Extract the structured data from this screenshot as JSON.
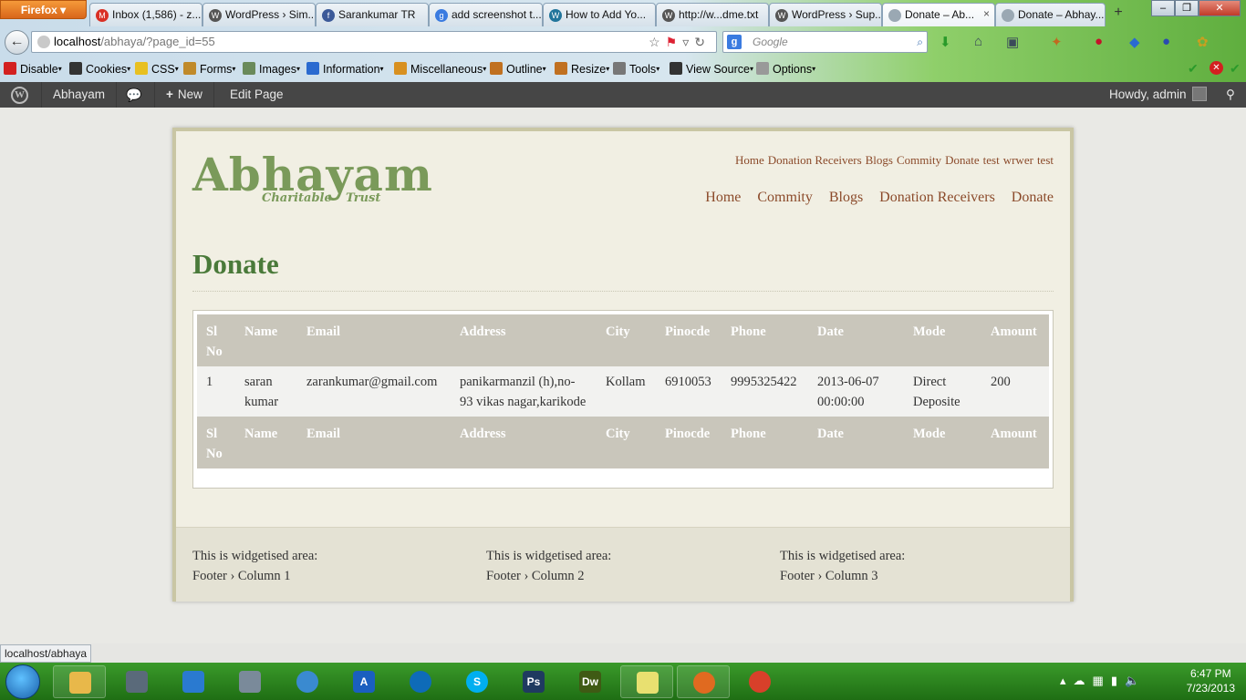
{
  "browser": {
    "app_button": "Firefox",
    "tabs": [
      {
        "label": "Inbox (1,586) - z...",
        "icon": "gmail-icon",
        "color": "#d93025",
        "glyph": "M"
      },
      {
        "label": "WordPress › Sim...",
        "icon": "wordpress-icon",
        "color": "#555555",
        "glyph": "W"
      },
      {
        "label": "Sarankumar TR",
        "icon": "facebook-icon",
        "color": "#3b5998",
        "glyph": "f"
      },
      {
        "label": "add screenshot t...",
        "icon": "google-icon",
        "color": "#3a7be0",
        "glyph": "g"
      },
      {
        "label": "How to Add Yo...",
        "icon": "wordpress-icon",
        "color": "#21759b",
        "glyph": "W"
      },
      {
        "label": "http://w...dme.txt",
        "icon": "wordpress-icon",
        "color": "#555555",
        "glyph": "W"
      },
      {
        "label": "WordPress › Sup...",
        "icon": "wordpress-icon",
        "color": "#555555",
        "glyph": "W"
      },
      {
        "label": "Donate – Ab...",
        "icon": "page-icon",
        "color": "#9aa8b3",
        "glyph": "",
        "active": true
      },
      {
        "label": "Donate – Abhay...",
        "icon": "page-icon",
        "color": "#9aa8b3",
        "glyph": ""
      }
    ],
    "new_tab": "+",
    "url_host": "localhost",
    "url_path": "/abhaya/?page_id=55",
    "search_placeholder": "Google",
    "search_engine": "g"
  },
  "webdev_toolbar": [
    {
      "label": "Disable",
      "color": "#d32020"
    },
    {
      "label": "Cookies",
      "color": "#333333"
    },
    {
      "label": "CSS",
      "color": "#e8c020"
    },
    {
      "label": "Forms",
      "color": "#c08a2a"
    },
    {
      "label": "Images",
      "color": "#6a8a5a"
    },
    {
      "label": "Information",
      "color": "#2a6ad0"
    },
    {
      "label": "Miscellaneous",
      "color": "#d89020"
    },
    {
      "label": "Outline",
      "color": "#c07020"
    },
    {
      "label": "Resize",
      "color": "#c07020"
    },
    {
      "label": "Tools",
      "color": "#777777"
    },
    {
      "label": "View Source",
      "color": "#333333"
    },
    {
      "label": "Options",
      "color": "#999999"
    }
  ],
  "admin_bar": {
    "site_name": "Abhayam",
    "new_label": "New",
    "new_prefix": "+",
    "edit_label": "Edit Page",
    "greeting": "Howdy, admin"
  },
  "site": {
    "logo_title": "Abhayam",
    "logo_sub_1": "Charitable",
    "logo_sub_2": "Trust",
    "top_menu": [
      "Home",
      "Donation Receivers",
      "Blogs",
      "Commity",
      "Donate",
      "test",
      "wrwer",
      "test"
    ],
    "main_menu": [
      "Home",
      "Commity",
      "Blogs",
      "Donation Receivers",
      "Donate"
    ],
    "page_title": "Donate",
    "table": {
      "headers": [
        "Sl No",
        "Name",
        "Email",
        "Address",
        "City",
        "Pinocde",
        "Phone",
        "Date",
        "Mode",
        "Amount"
      ],
      "rows": [
        [
          "1",
          "saran kumar",
          "zarankumar@gmail.com",
          "panikarmanzil (h),no-93 vikas nagar,karikode",
          "Kollam",
          "6910053",
          "9995325422",
          "2013-06-07 00:00:00",
          "Direct Deposite",
          "200"
        ]
      ]
    },
    "footer": [
      {
        "line1": "This is widgetised area:",
        "line2": "Footer › Column 1"
      },
      {
        "line1": "This is widgetised area:",
        "line2": "Footer › Column 2"
      },
      {
        "line1": "This is widgetised area:",
        "line2": "Footer › Column 3"
      }
    ]
  },
  "status_url": "localhost/abhaya",
  "taskbar": {
    "apps": [
      {
        "name": "explorer",
        "glyph": "",
        "color": "#e8b84a"
      },
      {
        "name": "network",
        "glyph": "",
        "color": "#5a6a7a"
      },
      {
        "name": "tool",
        "glyph": "",
        "color": "#2a7ad0"
      },
      {
        "name": "calculator",
        "glyph": "",
        "color": "#7a8a9a"
      },
      {
        "name": "safari",
        "glyph": "",
        "color": "#3a8ad0"
      },
      {
        "name": "app",
        "glyph": "A",
        "color": "#1a5fbf"
      },
      {
        "name": "teamviewer",
        "glyph": "",
        "color": "#0e6bb8"
      },
      {
        "name": "skype",
        "glyph": "S",
        "color": "#00aff0"
      },
      {
        "name": "photoshop",
        "glyph": "Ps",
        "color": "#1f3a60"
      },
      {
        "name": "dreamweaver",
        "glyph": "Dw",
        "color": "#3f5a14"
      },
      {
        "name": "notes",
        "glyph": "",
        "color": "#e8e070"
      },
      {
        "name": "firefox",
        "glyph": "",
        "color": "#e06a20"
      },
      {
        "name": "chrome",
        "glyph": "",
        "color": "#d8402a"
      }
    ],
    "time": "6:47 PM",
    "date": "7/23/2013"
  }
}
